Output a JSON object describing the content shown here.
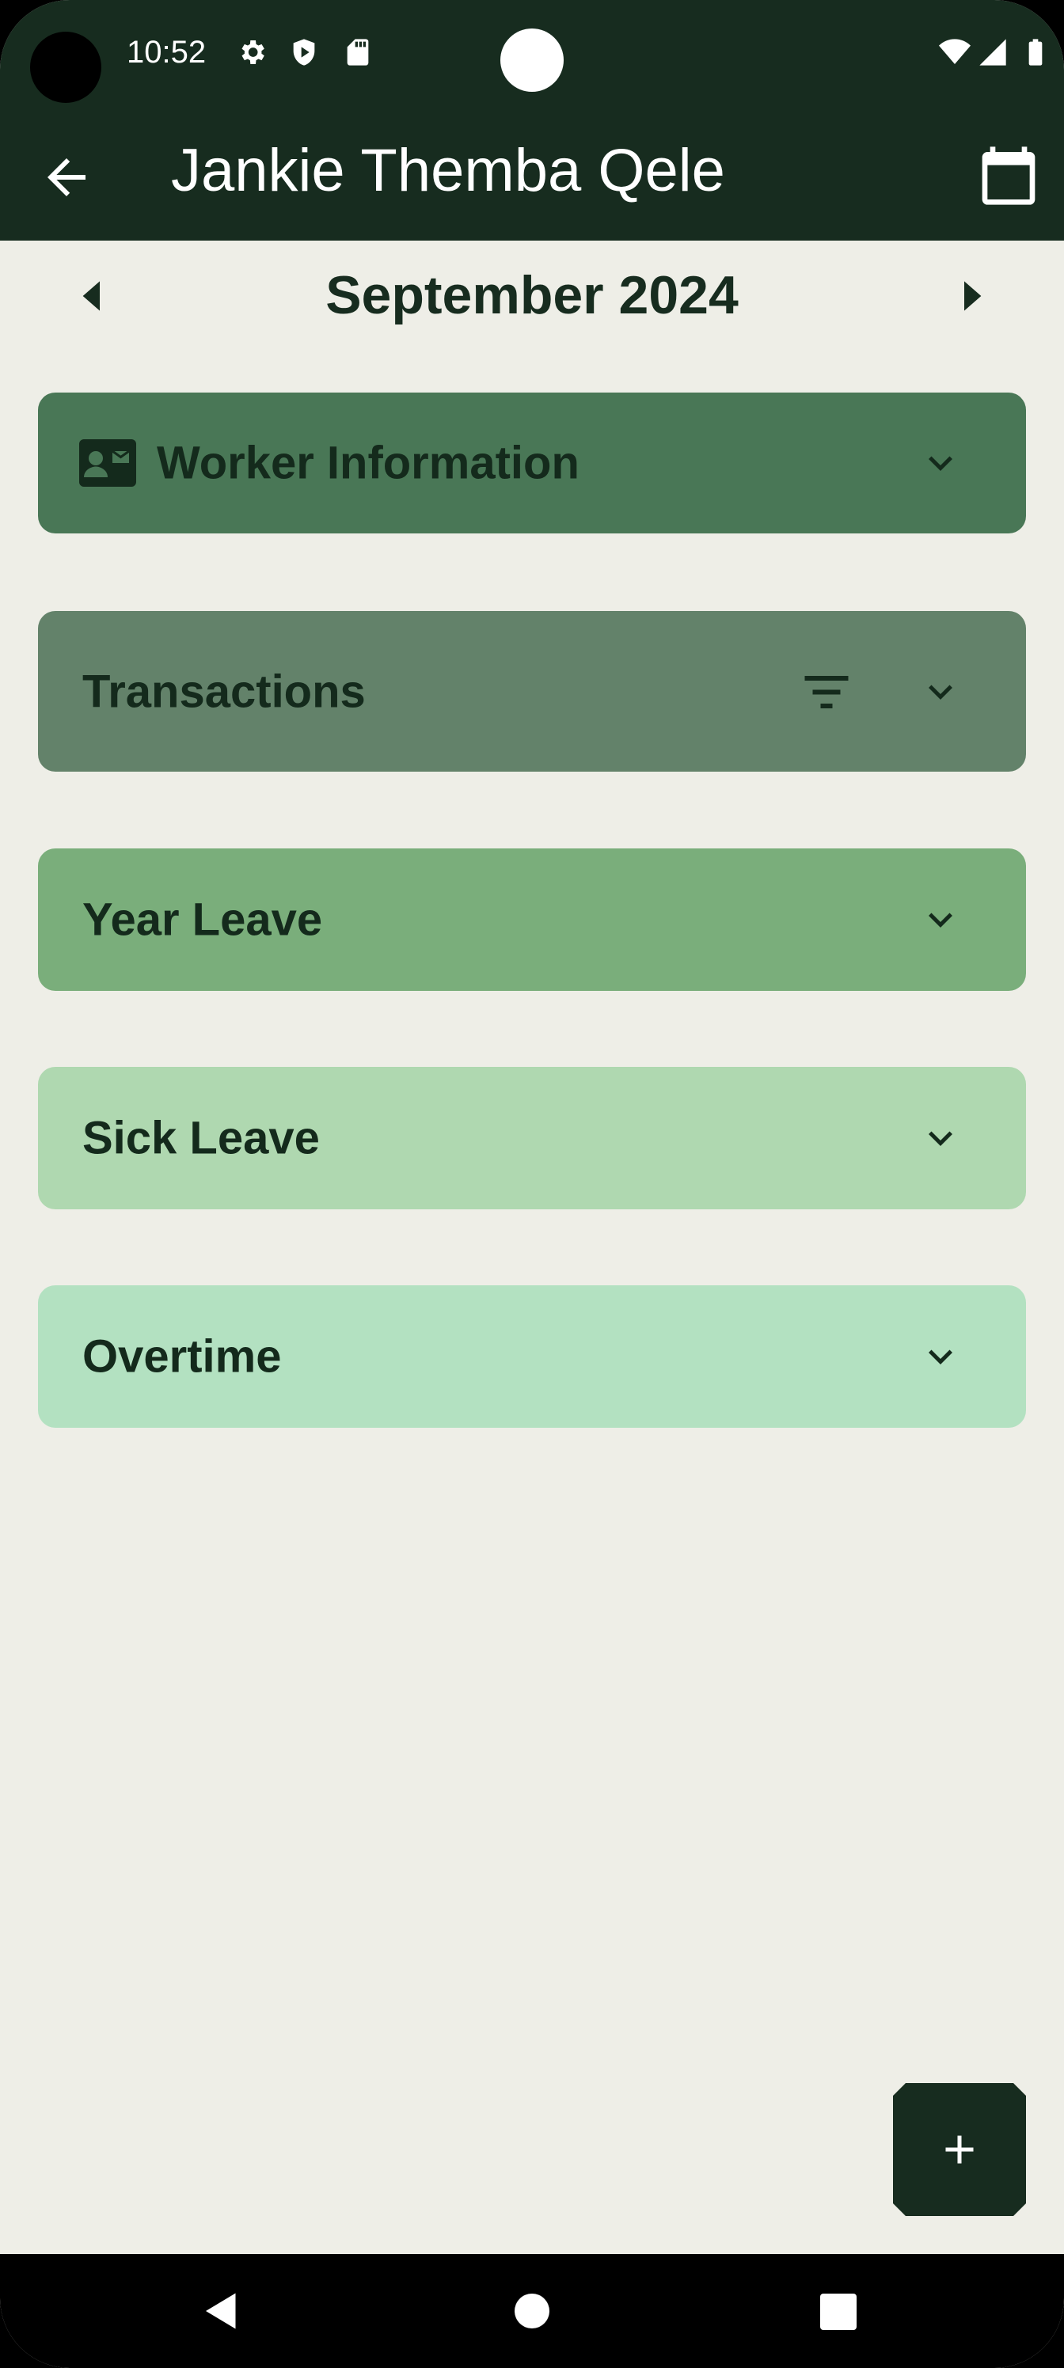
{
  "status_bar": {
    "time": "10:52"
  },
  "app_bar": {
    "title": "Jankie Themba Qele"
  },
  "month_nav": {
    "label": "September 2024"
  },
  "panels": [
    {
      "label": "Worker Information",
      "color": "#497756"
    },
    {
      "label": "Transactions",
      "color": "#63826a"
    },
    {
      "label": "Year Leave",
      "color": "#7aae7b"
    },
    {
      "label": "Sick Leave",
      "color": "#afd8b0"
    },
    {
      "label": "Overtime",
      "color": "#b3e1c1"
    }
  ],
  "colors": {
    "header": "#172c1f",
    "background": "#eeeee7",
    "text_dark": "#142a1c"
  },
  "icons": {
    "back": "arrow-left-icon",
    "calendar": "calendar-icon",
    "id_card": "contact-card-icon",
    "filter": "filter-icon",
    "expand": "chevron-down-icon",
    "fab": "plus-icon"
  }
}
